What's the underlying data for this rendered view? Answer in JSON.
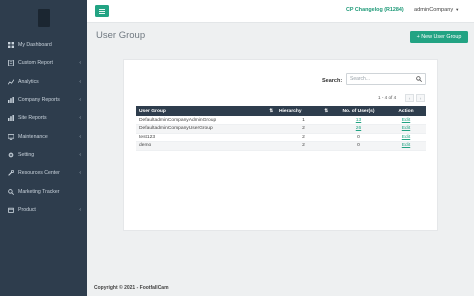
{
  "sidebar": {
    "items": [
      {
        "label": "My Dashboard",
        "icon": "dashboard-icon",
        "has_chevron": false
      },
      {
        "label": "Custom Report",
        "icon": "report-icon",
        "has_chevron": true
      },
      {
        "label": "Analytics",
        "icon": "chart-icon",
        "has_chevron": true
      },
      {
        "label": "Company Reports",
        "icon": "bar-chart-icon",
        "has_chevron": true
      },
      {
        "label": "Site Reports",
        "icon": "bar-chart-icon",
        "has_chevron": true
      },
      {
        "label": "Maintenance",
        "icon": "monitor-icon",
        "has_chevron": true
      },
      {
        "label": "Setting",
        "icon": "gear-icon",
        "has_chevron": true
      },
      {
        "label": "Resources Center",
        "icon": "wrench-icon",
        "has_chevron": true
      },
      {
        "label": "Marketing Tracker",
        "icon": "search-icon",
        "has_chevron": false
      },
      {
        "label": "Product",
        "icon": "box-icon",
        "has_chevron": true
      }
    ]
  },
  "topbar": {
    "changelog": "CP Changelog (R1284)",
    "user": "adminCompany",
    "caret": "▼"
  },
  "page": {
    "title": "User Group",
    "new_button": "+ New User Group"
  },
  "search": {
    "label": "Search:",
    "placeholder": "Search..."
  },
  "pager": {
    "info": "1 - 4 of 4",
    "prev": "‹",
    "next": "›"
  },
  "table": {
    "headers": {
      "name": "User Group",
      "hierarchy": "Hierarchy",
      "users": "No. of User(s)",
      "action": "Action"
    },
    "rows": [
      {
        "name": "DefaultadminCompanyAdminGroup",
        "hierarchy": "1",
        "users": "13",
        "users_link": true,
        "action": "Edit"
      },
      {
        "name": "DefaultadminCompanyUserGroup",
        "hierarchy": "2",
        "users": "26",
        "users_link": true,
        "action": "Edit"
      },
      {
        "name": "test123",
        "hierarchy": "2",
        "users": "0",
        "users_link": false,
        "action": "Edit"
      },
      {
        "name": "demo",
        "hierarchy": "2",
        "users": "0",
        "users_link": false,
        "action": "Edit"
      }
    ]
  },
  "footer": {
    "text": "Copyright © 2021 - FootfallCam"
  },
  "colors": {
    "accent": "#22a383",
    "sidebar_bg": "#2e3d4d",
    "page_bg": "#eef0f1"
  }
}
